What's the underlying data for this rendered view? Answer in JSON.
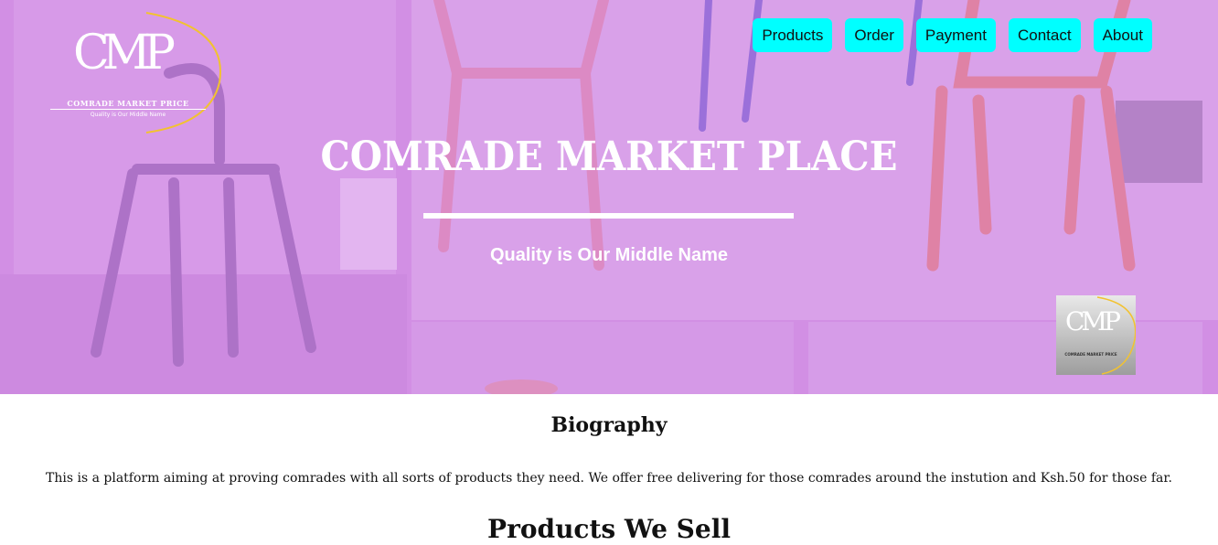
{
  "logo": {
    "monogram": "CMP",
    "name": "COMRADE MARKET PRICE",
    "tagline": "Quality is Our Middle Name"
  },
  "nav": {
    "items": [
      "Products",
      "Order",
      "Payment",
      "Contact",
      "About"
    ]
  },
  "hero": {
    "title": "COMRADE MARKET PLACE",
    "subtitle": "Quality is Our Middle Name"
  },
  "badge": {
    "monogram": "CMP",
    "name": "COMRADE MARKET PRICE"
  },
  "biography": {
    "heading": "Biography",
    "text": "This is a platform aiming at proving comrades with all sorts of products they need. We offer free delivering for those comrades around the instution and Ksh.50 for those far."
  },
  "products": {
    "heading": "Products We Sell"
  },
  "colors": {
    "nav_button": "#00ffff",
    "hero_tint": "#d88fef",
    "logo_arc": "#f2c230"
  }
}
